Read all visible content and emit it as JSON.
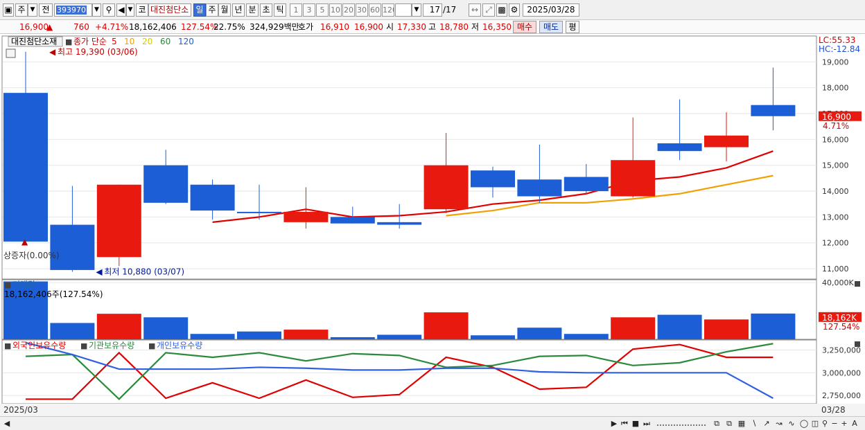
{
  "toolbar": {
    "period_main": "주",
    "side_label": "전",
    "stock_code": "393970",
    "code_prefix": "코",
    "stock_name": "대진첨단소",
    "periods": [
      "일",
      "주",
      "월",
      "년",
      "분",
      "초",
      "틱"
    ],
    "active_period": "일",
    "intervals": [
      "1",
      "3",
      "5",
      "10",
      "20",
      "30",
      "60",
      "120"
    ],
    "page_current": "17",
    "page_total": "/17",
    "date": "2025/03/28"
  },
  "quote": {
    "price": "16,900",
    "change_icon": "triangle-up",
    "change": "760",
    "change_pct": "+4.71%",
    "volume": "18,162,406",
    "volume_ratio": "127.54%",
    "turnover": "22.75%",
    "amount": "324,929백만",
    "hoga_label": "호가",
    "hoga_ask": "16,910",
    "hoga_bid": "16,900",
    "open_label": "시",
    "open": "17,330",
    "high_label": "고",
    "high": "18,780",
    "low_label": "저",
    "low": "16,350",
    "buy_label": "매수",
    "sell_label": "매도",
    "eval_label": "평"
  },
  "chart_data": [
    {
      "type": "candlestick",
      "title": "대진첨단소재",
      "legend": {
        "label": "종가 단순",
        "periods": [
          "5",
          "10",
          "20",
          "60",
          "120"
        ],
        "colors": [
          "#e00000",
          "#f0a000",
          "#d4cc00",
          "#2a8a3a",
          "#1a5fcc"
        ]
      },
      "ylim": [
        10600,
        20000
      ],
      "yticks": [
        11000,
        12000,
        13000,
        14000,
        15000,
        16000,
        17000,
        18000,
        19000
      ],
      "ytick_labels": [
        "11,000",
        "12,000",
        "13,000",
        "14,000",
        "15,000",
        "16,000",
        "17,000",
        "18,000",
        "19,000"
      ],
      "candles": [
        {
          "o": 17800,
          "h": 19390,
          "l": 12100,
          "c": 12050
        },
        {
          "o": 12700,
          "h": 14200,
          "l": 10880,
          "c": 10950
        },
        {
          "o": 11450,
          "h": 14250,
          "l": 11100,
          "c": 14250
        },
        {
          "o": 15000,
          "h": 15600,
          "l": 13500,
          "c": 13550
        },
        {
          "o": 14250,
          "h": 14450,
          "l": 12900,
          "c": 13250
        },
        {
          "o": 13200,
          "h": 14250,
          "l": 12900,
          "c": 13150
        },
        {
          "o": 12800,
          "h": 14150,
          "l": 12550,
          "c": 13200
        },
        {
          "o": 13000,
          "h": 13400,
          "l": 12750,
          "c": 12750
        },
        {
          "o": 12800,
          "h": 13500,
          "l": 12550,
          "c": 12700
        },
        {
          "o": 13300,
          "h": 16250,
          "l": 13150,
          "c": 15000
        },
        {
          "o": 14800,
          "h": 14950,
          "l": 13750,
          "c": 14150
        },
        {
          "o": 14450,
          "h": 15800,
          "l": 13550,
          "c": 13800
        },
        {
          "o": 14550,
          "h": 15050,
          "l": 13900,
          "c": 14000
        },
        {
          "o": 13800,
          "h": 16850,
          "l": 13750,
          "c": 15200
        },
        {
          "o": 15850,
          "h": 17550,
          "l": 15200,
          "c": 15550
        },
        {
          "o": 15700,
          "h": 17050,
          "l": 15150,
          "c": 16150
        },
        {
          "o": 17330,
          "h": 18780,
          "l": 16350,
          "c": 16900
        }
      ],
      "ma5": [
        null,
        null,
        null,
        null,
        12800,
        13000,
        13300,
        13000,
        13050,
        13200,
        13500,
        13650,
        13900,
        14400,
        14550,
        14900,
        15550
      ],
      "ma10": [
        null,
        null,
        null,
        null,
        null,
        null,
        null,
        null,
        null,
        13050,
        13250,
        13550,
        13550,
        13700,
        13900,
        14250,
        14600
      ],
      "high_annotation": "최고 19,390 (03/06)",
      "low_annotation": "최저 10,880 (03/07)",
      "listing_annotation": "상증자(0.00%)",
      "last_price_label": "16,900",
      "last_pct_label": "4.71%",
      "lc_label": "LC:55.33",
      "hc_label": "HC:-12.84"
    },
    {
      "type": "bar",
      "title": "거래량",
      "info": "18,162,406주(127.54%)",
      "ylim": [
        0,
        42000000
      ],
      "ytick_labels": [
        "40,000K"
      ],
      "values": [
        40800000,
        11500000,
        18000000,
        15500000,
        3800000,
        5500000,
        6800000,
        1500000,
        3200000,
        19000000,
        2800000,
        8200000,
        3800000,
        15500000,
        17300000,
        14000000,
        18162406
      ],
      "last_label": "18,162K",
      "last_pct_label": "127.54%"
    },
    {
      "type": "line",
      "series": [
        {
          "name": "외국인보유수량",
          "color": "#e00000",
          "values": [
            2710000,
            2710000,
            3220000,
            2720000,
            2890000,
            2720000,
            2920000,
            2730000,
            2760000,
            3170000,
            3060000,
            2820000,
            2840000,
            3260000,
            3310000,
            3170000,
            3170000
          ]
        },
        {
          "name": "기관보유수량",
          "color": "#2a8a3a",
          "values": [
            3180000,
            3200000,
            2710000,
            3220000,
            3170000,
            3220000,
            3130000,
            3210000,
            3190000,
            3060000,
            3080000,
            3180000,
            3190000,
            3080000,
            3110000,
            3230000,
            3320000
          ]
        },
        {
          "name": "개인보유수량",
          "color": "#3060e0",
          "values": [
            3330000,
            3200000,
            3040000,
            3040000,
            3040000,
            3060000,
            3050000,
            3030000,
            3030000,
            3050000,
            3050000,
            3010000,
            3000000,
            3000000,
            3000000,
            3000000,
            2720000
          ]
        }
      ],
      "ylim": [
        2660000,
        3360000
      ],
      "yticks": [
        2750000,
        3000000,
        3250000
      ],
      "ytick_labels": [
        "2,750,000",
        "3,000,000",
        "3,250,000"
      ]
    }
  ],
  "xaxis": {
    "left_label": "2025/03",
    "right_label": "03/28"
  }
}
